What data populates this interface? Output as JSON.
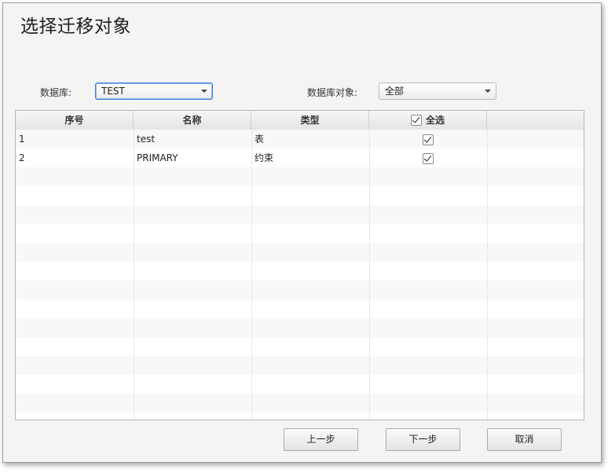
{
  "dialog": {
    "title": "选择迁移对象"
  },
  "filters": {
    "database_label": "数据库:",
    "database_value": "TEST",
    "object_label": "数据库对象:",
    "object_value": "全部"
  },
  "table": {
    "columns": [
      "序号",
      "名称",
      "类型",
      "全选",
      ""
    ],
    "select_all_checked": true,
    "rows": [
      {
        "index": "1",
        "name": "test",
        "type": "表",
        "checked": true
      },
      {
        "index": "2",
        "name": "PRIMARY",
        "type": "约束",
        "checked": true
      }
    ]
  },
  "buttons": {
    "prev": "上一步",
    "next": "下一步",
    "cancel": "取消"
  }
}
